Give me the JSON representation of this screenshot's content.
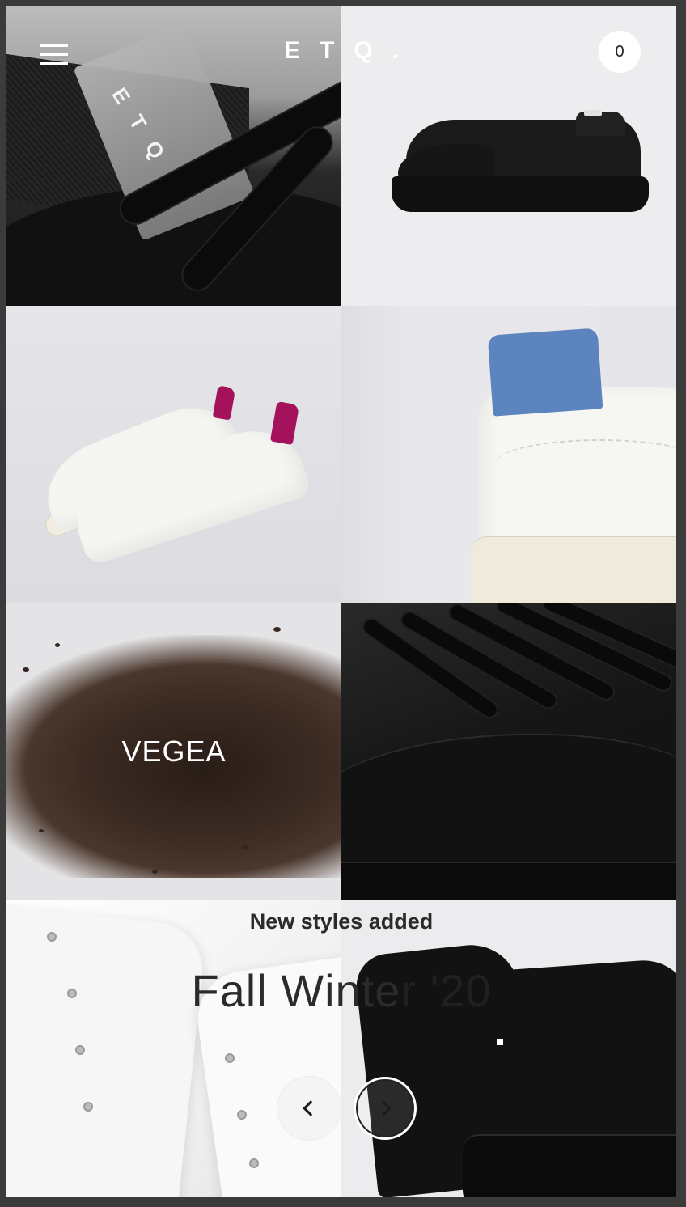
{
  "header": {
    "brand": "ETQ.",
    "cart_count": "0"
  },
  "tiles": [
    {
      "name": "Black low-top close-up with logo tag",
      "tag_text": "ETQ."
    },
    {
      "name": "Black low-top sneaker"
    },
    {
      "name": "White sneakers with magenta heel"
    },
    {
      "name": "White sneaker heel with blue tab"
    },
    {
      "name": "Coffee grounds material",
      "logo": "VEGEA"
    },
    {
      "name": "Black leather laces close-up"
    },
    {
      "name": "White leather laces close-up"
    },
    {
      "name": "Black high-top sneakers"
    }
  ],
  "hero": {
    "eyebrow": "New styles added",
    "headline_main": "Fall Winte",
    "headline_fade": "r '20"
  },
  "colors": {
    "magenta_heel": "#a3125a",
    "blue_tab": "#5c84bf"
  },
  "icons": {
    "menu": "hamburger-icon",
    "prev": "chevron-left-icon",
    "next": "chevron-right-icon"
  }
}
